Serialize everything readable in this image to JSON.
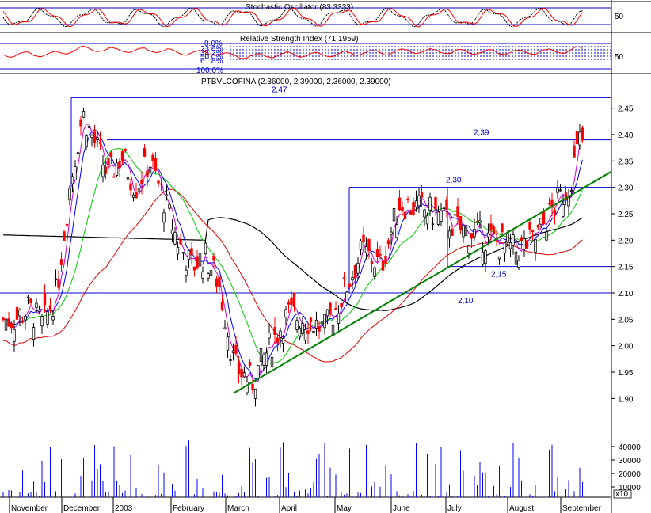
{
  "chart_data": {
    "type": "candlestick",
    "instrument_label": "PTBVLCOFINA (2.36000, 2.39000, 2.36000, 2.39000)",
    "oscillators": {
      "stochastic": {
        "title": "Stochastic Oscillator (83.3333)",
        "y_tick": "50"
      },
      "rsi": {
        "title": "Relative Strength Index (71.1959)",
        "y_tick": "50",
        "fib_labels": [
          "0.0%",
          "23.6%",
          "38.2%",
          "50.0%",
          "61.8%",
          "100.0%"
        ]
      }
    },
    "price_axis": {
      "ylim": [
        1.86,
        2.49
      ],
      "ticks": [
        "2.45",
        "2.40",
        "2.35",
        "2.30",
        "2.25",
        "2.20",
        "2.15",
        "2.10",
        "2.05",
        "2.00",
        "1.95",
        "1.90"
      ]
    },
    "volume_axis": {
      "ticks": [
        "40000",
        "30000",
        "20000",
        "10000"
      ],
      "unit_label": "x10"
    },
    "x_labels": [
      "November",
      "December",
      "2003",
      "February",
      "March",
      "April",
      "May",
      "June",
      "July",
      "August",
      "September"
    ],
    "horizontal_levels": [
      {
        "label": "2,47",
        "value": 2.47
      },
      {
        "label": "2,39",
        "value": 2.39
      },
      {
        "label": "2,30",
        "value": 2.3
      },
      {
        "label": "2,15",
        "value": 2.15
      },
      {
        "label": "2,10",
        "value": 2.1
      }
    ],
    "trendline": {
      "start": {
        "x_label": "March",
        "value": 1.91
      },
      "end": {
        "x_label": "September",
        "value": 2.33
      }
    },
    "close_path": [
      [
        "Nov",
        2.05
      ],
      [
        "Nov",
        2.07
      ],
      [
        "Nov",
        2.04
      ],
      [
        "Nov",
        2.1
      ],
      [
        "Dec",
        2.3
      ],
      [
        "Dec",
        2.44
      ],
      [
        "Dec",
        2.38
      ],
      [
        "Dec",
        2.32
      ],
      [
        "Jan",
        2.36
      ],
      [
        "Jan",
        2.3
      ],
      [
        "Jan",
        2.35
      ],
      [
        "Jan",
        2.28
      ],
      [
        "Feb",
        2.2
      ],
      [
        "Feb",
        2.15
      ],
      [
        "Feb",
        2.17
      ],
      [
        "Feb",
        2.12
      ],
      [
        "Mar",
        1.96
      ],
      [
        "Mar",
        1.93
      ],
      [
        "Mar",
        2.0
      ],
      [
        "Apr",
        2.06
      ],
      [
        "Apr",
        2.05
      ],
      [
        "Apr",
        2.03
      ],
      [
        "May",
        2.1
      ],
      [
        "May",
        2.18
      ],
      [
        "May",
        2.15
      ],
      [
        "Jun",
        2.27
      ],
      [
        "Jun",
        2.26
      ],
      [
        "Jun",
        2.25
      ],
      [
        "Jul",
        2.22
      ],
      [
        "Jul",
        2.2
      ],
      [
        "Aug",
        2.18
      ],
      [
        "Aug",
        2.2
      ],
      [
        "Aug",
        2.26
      ],
      [
        "Sep",
        2.3
      ],
      [
        "Sep",
        2.39
      ]
    ],
    "colors": {
      "up": "#000000",
      "down": "#ff0000",
      "ma_blue": "#0000ff",
      "ma_green": "#00cc00",
      "ma_red": "#dd0000",
      "ma_black": "#000000",
      "trend": "#008000",
      "volume": "#0000ff"
    }
  }
}
